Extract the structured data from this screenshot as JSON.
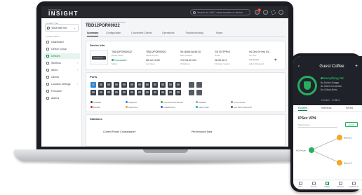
{
  "app": {
    "brand_small": "NETGEAR",
    "brand": "INSIGHT",
    "search_placeholder": "Search for MAC, serial number or device",
    "notification_count": "1"
  },
  "sidebar": {
    "location_label": "Location Tree",
    "location_value": "Your Bell Srl",
    "section_label": "Location Menu",
    "items": [
      {
        "label": "Dashboard",
        "has_arrow": false,
        "active": false
      },
      {
        "label": "Device Group",
        "has_arrow": false,
        "active": false
      },
      {
        "label": "Devices",
        "has_arrow": false,
        "active": true
      },
      {
        "label": "Wireless",
        "has_arrow": true,
        "active": false
      },
      {
        "label": "Wired",
        "has_arrow": true,
        "active": false
      },
      {
        "label": "Clients",
        "has_arrow": false,
        "active": false
      },
      {
        "label": "Location Settings",
        "has_arrow": true,
        "active": false
      },
      {
        "label": "Firmware",
        "has_arrow": false,
        "active": false
      },
      {
        "label": "Alarms",
        "has_arrow": false,
        "active": false
      }
    ]
  },
  "main": {
    "breadcrumb": "MSP Home/Organization/Location/Devices",
    "device_title": "TBD12POR00022",
    "tabs": [
      "Summary",
      "Configuration",
      "Connected Clients",
      "Operations",
      "Troubleshooting",
      "Notes"
    ],
    "device_info": {
      "title": "Device Info",
      "image_label": "",
      "fields": [
        {
          "value": "TBD12POR00022",
          "label": "Device Name"
        },
        {
          "value": "TBD12POR00022",
          "label": "Serial Number"
        },
        {
          "value": "94:18:65:3a:3b:10",
          "label": "MAC Address"
        },
        {
          "value": "GS724TPPv3",
          "label": "Model"
        },
        {
          "value": "04 Dec 09 Hrs 03...",
          "label": "Up Time"
        },
        {
          "value": "Connected",
          "label": "Status"
        },
        {
          "value": "28 Jul 14:05",
          "label": "Last Seen"
        },
        {
          "value": "172.16.32.101",
          "label": "IP Address"
        },
        {
          "value": "26.32.42.4",
          "label": "Firmware Version"
        },
        {
          "value": "**********",
          "label": "Admin Password"
        }
      ]
    },
    "ports": {
      "title": "Ports",
      "port_labels": [
        "1",
        "",
        "",
        "",
        "",
        "",
        "",
        "",
        "",
        "",
        "",
        "",
        "",
        "",
        "",
        "",
        "",
        "",
        "",
        "",
        "",
        "",
        "",
        ""
      ],
      "legend": [
        {
          "label": "Available",
          "color": "#3b3f47"
        },
        {
          "label": "Assigned",
          "color": "#1e88e5"
        },
        {
          "label": "Connected & Powered",
          "color": "#27ae60"
        },
        {
          "label": "Disabled",
          "color": "#9aa0a8"
        },
        {
          "label": "Unconnected",
          "color": "#8a8f98"
        },
        {
          "label": "Blocked",
          "color": "#e0322b"
        },
        {
          "label": "Authorized",
          "color": "#f5a623"
        },
        {
          "label": "Unauthorized",
          "color": "#6c3bd1"
        },
        {
          "label": "Active Scan",
          "color": "#00acc1"
        },
        {
          "label": "10G SFP+ Fiber Port",
          "color": "#555a63"
        }
      ]
    },
    "statistics": {
      "title": "Statistics",
      "left": "Current Power Consumption*",
      "right": "Performance Data"
    }
  },
  "phone": {
    "title": "Guest Coffee",
    "subtitle": "",
    "status_main": "Everything OK",
    "status_lines": [
      "No Device Outage",
      "No Client Connection",
      "No Critical Alerts"
    ],
    "online_text": "5 Online  ·  0 Offline",
    "tabs": [
      "Routers",
      "Wireless",
      "Wired"
    ],
    "section": "IPSec VPN",
    "select_placeholder": "Select Group",
    "export_label": "Export",
    "nodes": [
      "HQ Router",
      "Branch 1",
      "Branch 2"
    ],
    "nav": [
      "Home",
      "Devices",
      "Insight",
      "Locations",
      "Notifications"
    ],
    "accent_color": "#27ae60"
  }
}
